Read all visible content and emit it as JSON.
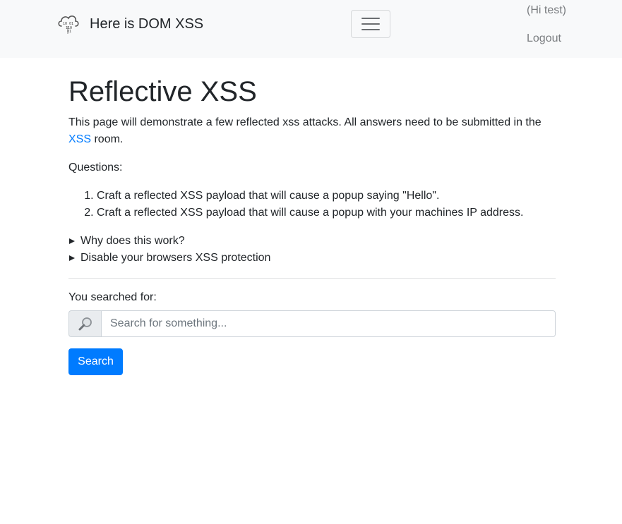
{
  "navbar": {
    "brand": "Here is DOM XSS",
    "logo_icon": "cloud-binary-icon",
    "toggler_icon": "hamburger-icon",
    "user_greeting": "(Hi test)",
    "logout": "Logout"
  },
  "main": {
    "title": "Reflective XSS",
    "intro_text": "This page will demonstrate a few reflected xss attacks. All answers need to be submitted in the",
    "intro_link": "XSS",
    "intro_suffix": "room.",
    "questions_label": "Questions:",
    "questions": [
      "Craft a reflected XSS payload that will cause a popup saying \"Hello\".",
      "Craft a reflected XSS payload that will cause a popup with your machines IP address."
    ],
    "details": [
      "Why does this work?",
      "Disable your browsers XSS protection"
    ],
    "searched_label": "You searched for:",
    "search_icon": "magnifier-icon",
    "search_placeholder": "Search for something...",
    "search_value": "",
    "search_button": "Search"
  },
  "colors": {
    "navbar_bg": "#f8f9fa",
    "link": "#007bff",
    "primary_button": "#007bff",
    "nav_text": "#7a7d80"
  }
}
